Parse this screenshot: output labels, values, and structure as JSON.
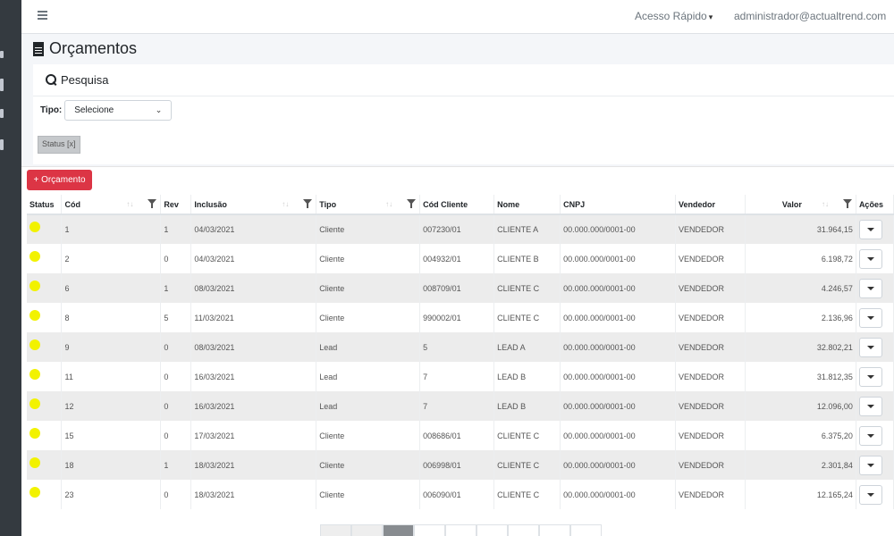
{
  "topbar": {
    "quick_access": "Acesso Rápido",
    "user": "administrador@actualtrend.com"
  },
  "page": {
    "title": "Orçamentos"
  },
  "search": {
    "title": "Pesquisa",
    "tipo_label": "Tipo:",
    "tipo_value": "Selecione",
    "status_chip": "Status [x]"
  },
  "actions": {
    "add_button": "+ Orçamento"
  },
  "table": {
    "columns": [
      "Status",
      "Cód",
      "Rev",
      "Inclusão",
      "Tipo",
      "Cód Cliente",
      "Nome",
      "CNPJ",
      "Vendedor",
      "Valor",
      "Ações"
    ],
    "rows": [
      {
        "cod": "1",
        "rev": "1",
        "inclusao": "04/03/2021",
        "tipo": "Cliente",
        "cod_cliente": "007230/01",
        "nome": "CLIENTE A",
        "cnpj": "00.000.000/0001-00",
        "vendedor": "VENDEDOR",
        "valor": "31.964,15"
      },
      {
        "cod": "2",
        "rev": "0",
        "inclusao": "04/03/2021",
        "tipo": "Cliente",
        "cod_cliente": "004932/01",
        "nome": "CLIENTE B",
        "cnpj": "00.000.000/0001-00",
        "vendedor": "VENDEDOR",
        "valor": "6.198,72"
      },
      {
        "cod": "6",
        "rev": "1",
        "inclusao": "08/03/2021",
        "tipo": "Cliente",
        "cod_cliente": "008709/01",
        "nome": "CLIENTE C",
        "cnpj": "00.000.000/0001-00",
        "vendedor": "VENDEDOR",
        "valor": "4.246,57"
      },
      {
        "cod": "8",
        "rev": "5",
        "inclusao": "11/03/2021",
        "tipo": "Cliente",
        "cod_cliente": "990002/01",
        "nome": "CLIENTE C",
        "cnpj": "00.000.000/0001-00",
        "vendedor": "VENDEDOR",
        "valor": "2.136,96"
      },
      {
        "cod": "9",
        "rev": "0",
        "inclusao": "08/03/2021",
        "tipo": "Lead",
        "cod_cliente": "5",
        "nome": "LEAD A",
        "cnpj": "00.000.000/0001-00",
        "vendedor": "VENDEDOR",
        "valor": "32.802,21"
      },
      {
        "cod": "11",
        "rev": "0",
        "inclusao": "16/03/2021",
        "tipo": "Lead",
        "cod_cliente": "7",
        "nome": "LEAD B",
        "cnpj": "00.000.000/0001-00",
        "vendedor": "VENDEDOR",
        "valor": "31.812,35"
      },
      {
        "cod": "12",
        "rev": "0",
        "inclusao": "16/03/2021",
        "tipo": "Lead",
        "cod_cliente": "7",
        "nome": "LEAD B",
        "cnpj": "00.000.000/0001-00",
        "vendedor": "VENDEDOR",
        "valor": "12.096,00"
      },
      {
        "cod": "15",
        "rev": "0",
        "inclusao": "17/03/2021",
        "tipo": "Cliente",
        "cod_cliente": "008686/01",
        "nome": "CLIENTE C",
        "cnpj": "00.000.000/0001-00",
        "vendedor": "VENDEDOR",
        "valor": "6.375,20"
      },
      {
        "cod": "18",
        "rev": "1",
        "inclusao": "18/03/2021",
        "tipo": "Cliente",
        "cod_cliente": "006998/01",
        "nome": "CLIENTE C",
        "cnpj": "00.000.000/0001-00",
        "vendedor": "VENDEDOR",
        "valor": "2.301,84"
      },
      {
        "cod": "23",
        "rev": "0",
        "inclusao": "18/03/2021",
        "tipo": "Cliente",
        "cod_cliente": "006090/01",
        "nome": "CLIENTE C",
        "cnpj": "00.000.000/0001-00",
        "vendedor": "VENDEDOR",
        "valor": "12.165,24"
      }
    ]
  },
  "colors": {
    "status_dot": "#f2f200",
    "danger": "#dc3545",
    "sidebar": "#343a40"
  }
}
